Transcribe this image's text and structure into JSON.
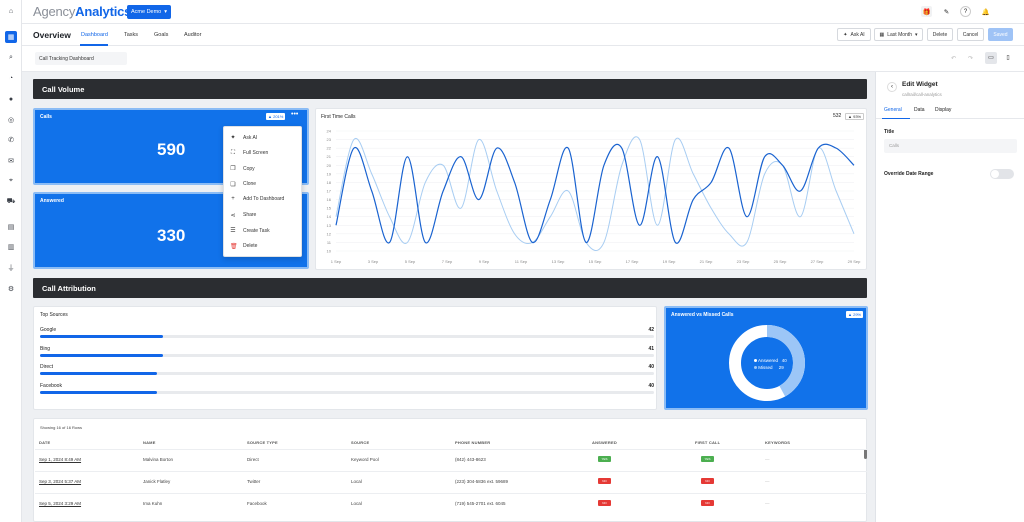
{
  "app": {
    "logo_light": "Agency",
    "logo_bold": "Analytics",
    "client": "Acme Demo"
  },
  "header": {
    "title": "Overview",
    "tabs": [
      {
        "label": "Dashboard"
      },
      {
        "label": "Tasks"
      },
      {
        "label": "Goals"
      },
      {
        "label": "Auditor"
      }
    ],
    "ask_ai": "Ask AI",
    "range": "Last Month",
    "delete": "Delete",
    "cancel": "Cancel",
    "saved": "Saved"
  },
  "dashboard_name": "Call Tracking Dashboard",
  "call_volume": {
    "title": "Call Volume",
    "calls": {
      "label": "Calls",
      "value": "590",
      "badge": "201%"
    },
    "answered": {
      "label": "Answered",
      "value": "330"
    },
    "first_time": {
      "label": "First Time Calls",
      "value": "532",
      "badge": "93%"
    }
  },
  "menu": {
    "items": [
      {
        "label": "Ask AI",
        "icon": "sparkle-icon",
        "glyph": "✦"
      },
      {
        "label": "Full Screen",
        "icon": "fullscreen-icon",
        "glyph": "⛶"
      },
      {
        "label": "Copy",
        "icon": "copy-icon",
        "glyph": "❐"
      },
      {
        "label": "Clone",
        "icon": "clone-icon",
        "glyph": "❏"
      },
      {
        "label": "Add To Dashboard",
        "icon": "plus-icon",
        "glyph": "+"
      },
      {
        "label": "Share",
        "icon": "share-icon",
        "glyph": "⋖"
      },
      {
        "label": "Create Task",
        "icon": "list-icon",
        "glyph": "☰"
      },
      {
        "label": "Delete",
        "icon": "trash-icon",
        "glyph": "🗑"
      }
    ]
  },
  "chart_data": {
    "type": "line",
    "title": "First Time Calls",
    "x": [
      "1 Sep",
      "3 Sep",
      "5 Sep",
      "7 Sep",
      "9 Sep",
      "11 Sep",
      "13 Sep",
      "15 Sep",
      "17 Sep",
      "19 Sep",
      "21 Sep",
      "23 Sep",
      "25 Sep",
      "27 Sep",
      "29 Sep"
    ],
    "ylim": [
      10,
      24
    ],
    "yticks": [
      10,
      11,
      12,
      13,
      14,
      15,
      16,
      17,
      18,
      19,
      20,
      21,
      22,
      23,
      24
    ],
    "series": [
      {
        "values": [
          13,
          22,
          17,
          11,
          21,
          11,
          17,
          21,
          16,
          22,
          18,
          11,
          16,
          22,
          11,
          20,
          22,
          13,
          21,
          11,
          16,
          18,
          22,
          14,
          21,
          20,
          17,
          22,
          22,
          20
        ]
      },
      {
        "values": [
          14,
          23,
          19,
          14,
          11,
          18,
          20,
          15,
          23,
          17,
          12,
          11,
          14,
          17,
          11,
          11,
          20,
          23,
          13,
          23,
          19,
          15,
          12,
          11,
          19,
          20,
          14,
          22,
          17,
          12
        ]
      }
    ]
  },
  "attribution": {
    "title": "Call Attribution",
    "top_sources_label": "Top Sources",
    "sources": [
      {
        "name": "Google",
        "value": "42",
        "fraction": 0.2
      },
      {
        "name": "Bing",
        "value": "41",
        "fraction": 0.2
      },
      {
        "name": "Direct",
        "value": "40",
        "fraction": 0.19
      },
      {
        "name": "Facebook",
        "value": "40",
        "fraction": 0.19
      }
    ],
    "donut": {
      "title": "Answered vs Missed Calls",
      "badge": "29%",
      "answered_label": "Answered",
      "answered_value": "40",
      "missed_label": "Missed",
      "missed_value": "29"
    }
  },
  "table": {
    "showing": "Showing 16 of 16 Rows",
    "headers": [
      "DATE",
      "NAME",
      "SOURCE TYPE",
      "SOURCE",
      "PHONE NUMBER",
      "ANSWERED",
      "FIRST CALL",
      "KEYWORDS"
    ],
    "rows": [
      {
        "date": "Sep 1, 2024 8:49 AM",
        "name": "Malvina Borton",
        "type": "Direct",
        "source": "Keyword Pool",
        "phone": "(842) 443-8623",
        "answered": "YES",
        "first": "YES",
        "kw": "—"
      },
      {
        "date": "Sep 3, 2024 5:37 AM",
        "name": "Janick Flatley",
        "type": "Twitter",
        "source": "Local",
        "phone": "(223) 304-5836 ext. 59689",
        "answered": "NO",
        "first": "NO",
        "kw": "—"
      },
      {
        "date": "Sep 5, 2024 3:29 AM",
        "name": "Ima Kuhn",
        "type": "Facebook",
        "source": "Local",
        "phone": "(719) 545-2701 ext. 6045",
        "answered": "NO",
        "first": "NO",
        "kw": "—"
      }
    ]
  },
  "panel": {
    "title": "Edit Widget",
    "subtitle": "callrail/call-analytics",
    "tabs": [
      "General",
      "Data",
      "Display"
    ],
    "field_title": "Title",
    "field_value": "Calls",
    "override": "Override Date Range"
  },
  "colors": {
    "accent": "#1166e8",
    "yes": "#4caf50",
    "no": "#e53935"
  }
}
